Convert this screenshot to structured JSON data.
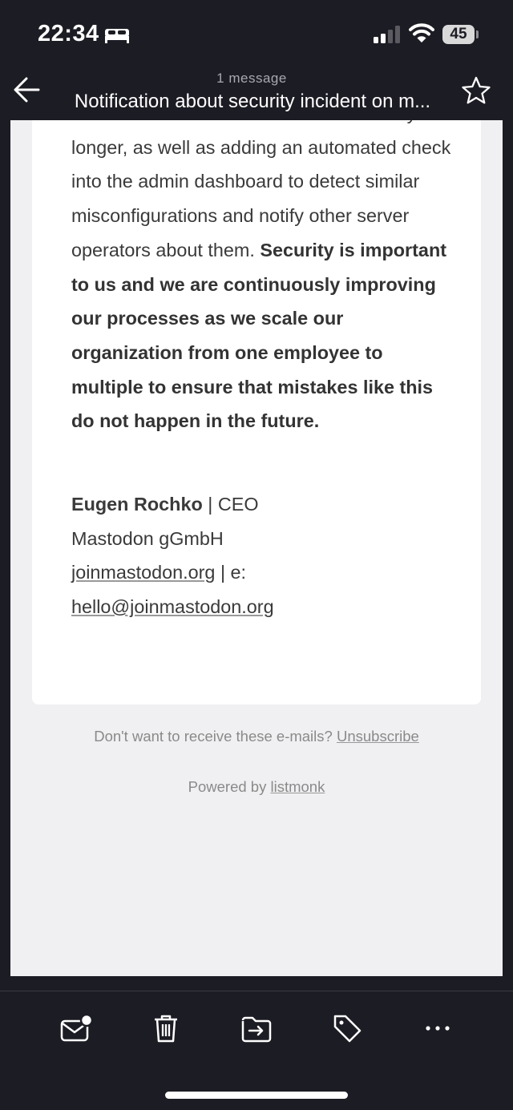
{
  "status_bar": {
    "time": "22:34",
    "battery": "45"
  },
  "header": {
    "message_count": "1 message",
    "subject": "Notification about security incident on m..."
  },
  "email": {
    "text_plain": "for access control to archive takeouts any longer, as well as adding an automated check into the admin dashboard to detect similar misconfigurations and notify other server operators about them. ",
    "text_bold": "Security is important to us and we are continuously improving our processes as we scale our organization from one employee to multiple to ensure that mistakes like this do not happen in the future.",
    "signature": {
      "name": "Eugen Rochko",
      "role": " | CEO",
      "company": "Mastodon gGmbH",
      "website": "joinmastodon.org",
      "email_label": " | e:",
      "email": "hello@joinmastodon.org"
    }
  },
  "footer": {
    "unsubscribe_text": "Don't want to receive these e-mails? ",
    "unsubscribe_link": "Unsubscribe",
    "powered_text": "Powered by ",
    "powered_link": "listmonk"
  },
  "toolbar": {
    "icons": [
      "mark-unread-icon",
      "trash-icon",
      "move-icon",
      "tag-icon",
      "more-icon"
    ]
  }
}
